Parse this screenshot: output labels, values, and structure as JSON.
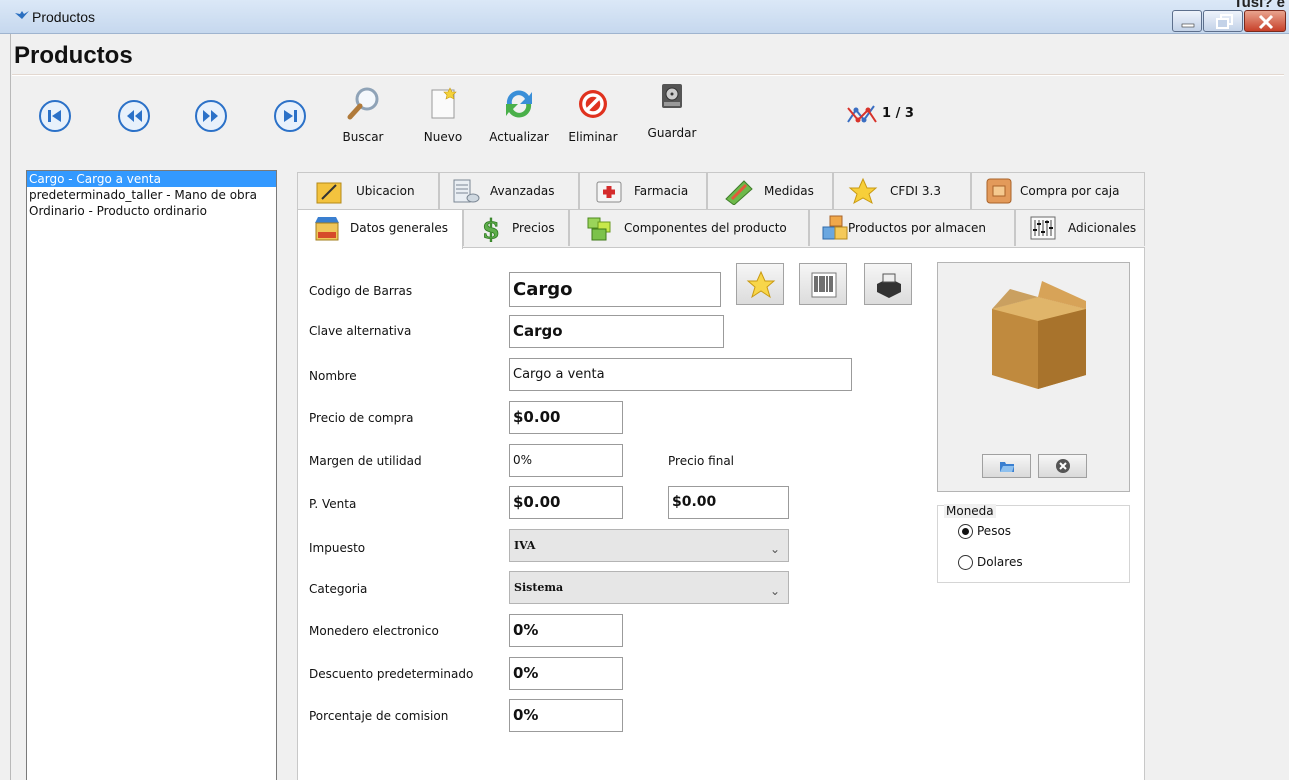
{
  "window": {
    "title": "Productos",
    "corner_text": "Tusi? e"
  },
  "page_title": "Productos",
  "toolbar": {
    "nav_icons": [
      "first-record-icon",
      "previous-record-icon",
      "next-record-icon",
      "last-record-icon"
    ],
    "buttons": [
      {
        "label": "Buscar",
        "icon": "magnifier-icon"
      },
      {
        "label": "Nuevo",
        "icon": "new-document-icon"
      },
      {
        "label": "Actualizar",
        "icon": "refresh-icon"
      },
      {
        "label": "Eliminar",
        "icon": "delete-icon"
      },
      {
        "label": "Guardar",
        "icon": "save-disk-icon"
      }
    ],
    "record_position": "1 / 3"
  },
  "product_list": [
    {
      "label": "Cargo - Cargo a venta",
      "selected": true
    },
    {
      "label": "predeterminado_taller - Mano de obra",
      "selected": false
    },
    {
      "label": "Ordinario - Producto ordinario",
      "selected": false
    }
  ],
  "tabs_row1": [
    {
      "label": "Ubicacion",
      "icon": "location-folder-icon"
    },
    {
      "label": "Avanzadas",
      "icon": "server-stack-icon"
    },
    {
      "label": "Farmacia",
      "icon": "first-aid-icon"
    },
    {
      "label": "Medidas",
      "icon": "ruler-icon"
    },
    {
      "label": "CFDI 3.3",
      "icon": "star-icon"
    },
    {
      "label": "Compra por caja",
      "icon": "box-icon"
    }
  ],
  "tabs_row2": [
    {
      "label": "Datos generales",
      "icon": "store-icon",
      "active": true
    },
    {
      "label": "Precios",
      "icon": "dollar-icon",
      "active": false
    },
    {
      "label": "Componentes del producto",
      "icon": "components-icon",
      "active": false
    },
    {
      "label": "Productos por almacen",
      "icon": "warehouse-boxes-icon",
      "active": false
    },
    {
      "label": "Adicionales",
      "icon": "equalizer-icon",
      "active": false
    }
  ],
  "form": {
    "codigo_barras": {
      "label": "Codigo de Barras",
      "value": "Cargo"
    },
    "clave_alternativa": {
      "label": "Clave alternativa",
      "value": "Cargo"
    },
    "nombre": {
      "label": "Nombre",
      "value": "Cargo a venta"
    },
    "precio_compra": {
      "label": "Precio de compra",
      "value": "$0.00"
    },
    "margen_utilidad": {
      "label": "Margen de utilidad",
      "value": "0%"
    },
    "precio_final": {
      "label": "Precio final",
      "value": "$0.00"
    },
    "p_venta": {
      "label": "P. Venta",
      "value": "$0.00"
    },
    "impuesto": {
      "label": "Impuesto",
      "value": "IVA"
    },
    "categoria": {
      "label": "Categoria",
      "value": "Sistema"
    },
    "monedero": {
      "label": "Monedero electronico",
      "value": "0%"
    },
    "descuento": {
      "label": "Descuento predeterminado",
      "value": "0%"
    },
    "comision": {
      "label": "Porcentaje de comision",
      "value": "0%"
    }
  },
  "moneda": {
    "label": "Moneda",
    "options": [
      {
        "label": "Pesos",
        "checked": true
      },
      {
        "label": "Dolares",
        "checked": false
      }
    ]
  }
}
